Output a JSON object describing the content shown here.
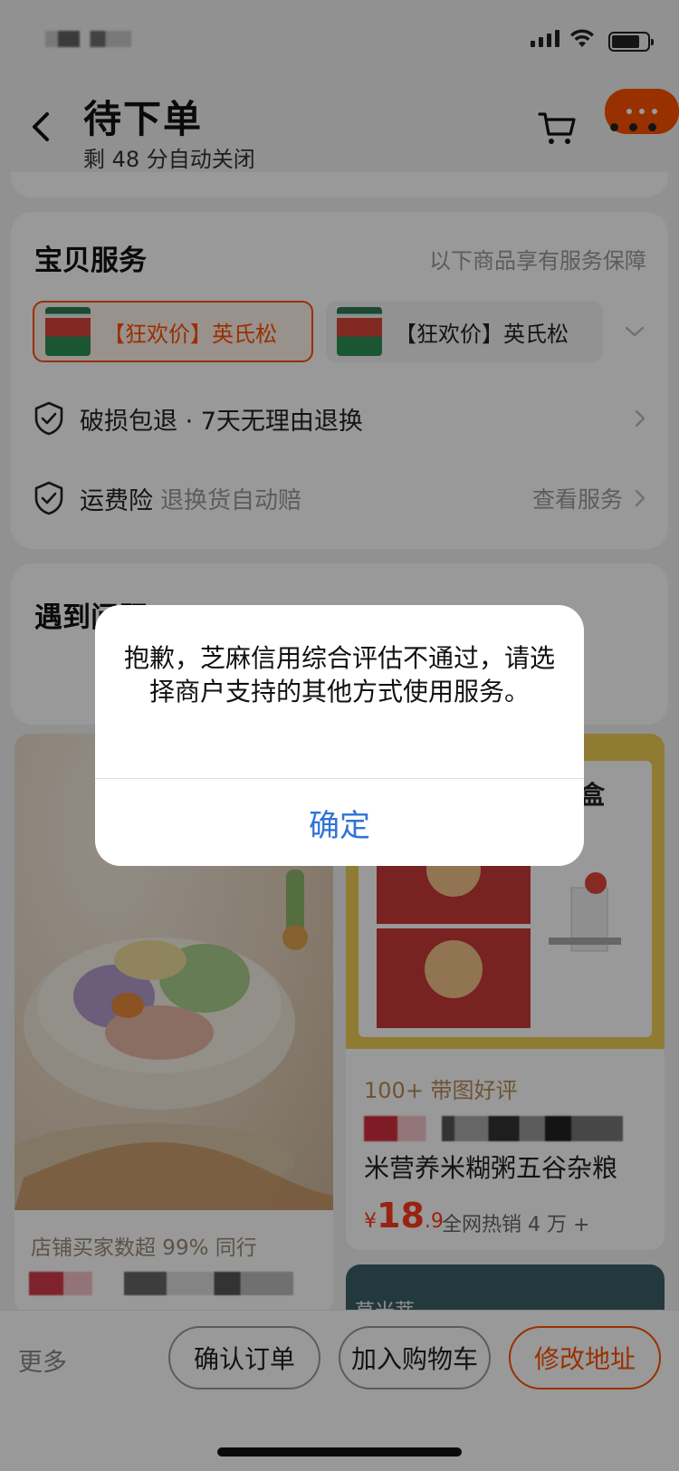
{
  "header": {
    "title": "待下单",
    "subtitle": "剩 48 分自动关闭"
  },
  "service": {
    "title": "宝贝服务",
    "note": "以下商品享有服务保障",
    "chips": [
      {
        "label": "【狂欢价】英氏松"
      },
      {
        "label": "【狂欢价】英氏松"
      }
    ],
    "rows": [
      {
        "label": "破损包退 · 7天无理由退换",
        "desc": "",
        "link": ""
      },
      {
        "label": "运费险",
        "desc": "退换货自动赔",
        "link": "查看服务"
      }
    ]
  },
  "problem": {
    "title": "遇到问题?"
  },
  "products": {
    "left": {
      "note": "店铺买家数超 99% 同行"
    },
    "right": {
      "box_title": "盒",
      "review_tag": "100+ 带图好评",
      "name": "米营养米糊粥五谷杂粮",
      "price_symbol": "¥",
      "price_int": "18",
      "price_dec": ".9",
      "sales": "全网热销 4 万 +"
    },
    "right2": {
      "text": "草米蒂"
    }
  },
  "bottom_bar": {
    "more": "更多",
    "confirm": "确认订单",
    "add_cart": "加入购物车",
    "edit_address": "修改地址"
  },
  "dialog": {
    "message": "抱歉，芝麻信用综合评估不通过，请选择商户支持的其他方式使用服务。",
    "ok": "确定"
  },
  "colors": {
    "accent": "#ff5000",
    "link_blue": "#2f73d6"
  },
  "icons": [
    "back-arrow-icon",
    "cart-icon",
    "more-icon",
    "shield-check-icon",
    "chevron-right-icon",
    "chevron-down-icon"
  ]
}
